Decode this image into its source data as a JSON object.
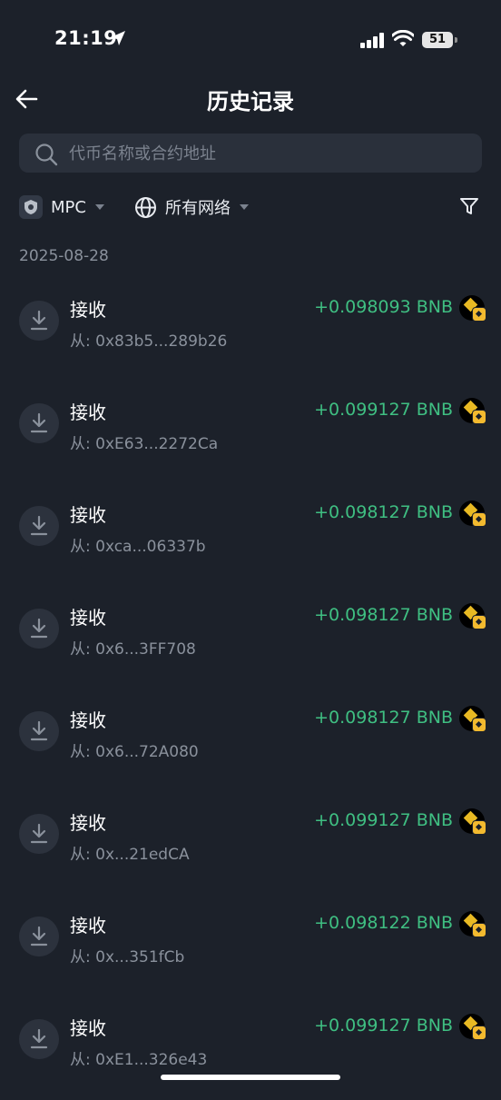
{
  "status_bar": {
    "time": "21:19",
    "battery": "51"
  },
  "header": {
    "title": "历史记录"
  },
  "search": {
    "placeholder": "代币名称或合约地址"
  },
  "filters": {
    "wallet": "MPC",
    "network": "所有网络"
  },
  "date_group": "2025-08-28",
  "transactions": [
    {
      "type": "接收",
      "from": "从: 0x83b5...289b26",
      "amount": "+0.098093 BNB"
    },
    {
      "type": "接收",
      "from": "从: 0xE63...2272Ca",
      "amount": "+0.099127 BNB"
    },
    {
      "type": "接收",
      "from": "从: 0xca...06337b",
      "amount": "+0.098127 BNB"
    },
    {
      "type": "接收",
      "from": "从: 0x6...3FF708",
      "amount": "+0.098127 BNB"
    },
    {
      "type": "接收",
      "from": "从: 0x6...72A080",
      "amount": "+0.098127 BNB"
    },
    {
      "type": "接收",
      "from": "从: 0x...21edCA",
      "amount": "+0.099127 BNB"
    },
    {
      "type": "接收",
      "from": "从: 0x...351fCb",
      "amount": "+0.098122 BNB"
    },
    {
      "type": "接收",
      "from": "从: 0xE1...326e43",
      "amount": "+0.099127 BNB"
    }
  ],
  "colors": {
    "background": "#1c212a",
    "positive_amount": "#3fbf82",
    "muted_text": "#8a919c",
    "token": "#f3ba2f"
  },
  "icons": {
    "back": "arrow-left-icon",
    "search": "search-icon",
    "filter": "funnel-icon",
    "network": "globe-icon",
    "wallet": "shield-icon",
    "receive": "download-icon",
    "token": "bnb-coin-icon"
  }
}
